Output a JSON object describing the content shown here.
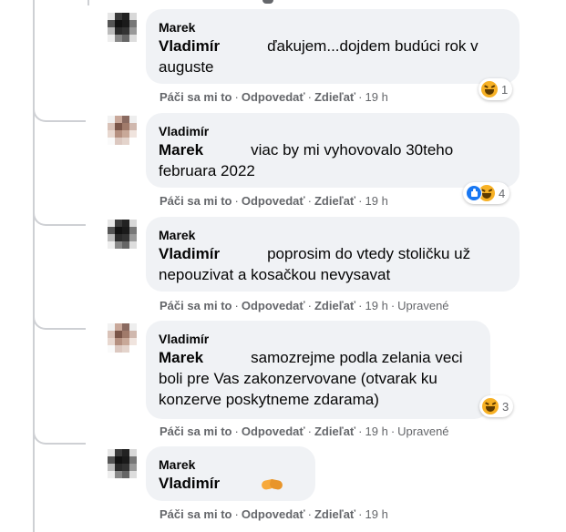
{
  "actions": {
    "like": "Páči sa mi to",
    "reply": "Odpovedať",
    "share": "Zdieľať",
    "separator": "·"
  },
  "comments": [
    {
      "author": "Marek",
      "mention": "Vladimír",
      "text": "ďakujem...dojdem budúci rok v auguste",
      "time": "19 h",
      "edited": "",
      "reactions": {
        "icons": [
          "haha-icon"
        ],
        "count": "1"
      }
    },
    {
      "author": "Vladimír",
      "mention": "Marek",
      "text": "viac by mi vyhovovalo 30teho februara 2022",
      "time": "19 h",
      "edited": "",
      "reactions": {
        "icons": [
          "like-icon",
          "haha-icon"
        ],
        "count": "4"
      }
    },
    {
      "author": "Marek",
      "mention": "Vladimír",
      "text": "poprosim do vtedy stoličku už nepouzivat a kosačkou nevysavat",
      "time": "19 h",
      "edited": "Upravené",
      "reactions": null
    },
    {
      "author": "Vladimír",
      "mention": "Marek",
      "text": "samozrejme podla zelania veci boli pre Vas zakonzervovane (otvarak ku konzerve poskytneme zdarama)",
      "time": "19 h",
      "edited": "Upravené",
      "reactions": {
        "icons": [
          "haha-icon"
        ],
        "count": "3"
      }
    },
    {
      "author": "Marek",
      "mention": "Vladimír",
      "text": "",
      "emoji": "handshake-icon",
      "time": "19 h",
      "edited": "",
      "reactions": null
    }
  ],
  "colors": {
    "bubble": "#f0f2f5",
    "meta_text": "#65676b",
    "like_blue": "#1877f2",
    "haha_yellow": "#f7b125"
  }
}
